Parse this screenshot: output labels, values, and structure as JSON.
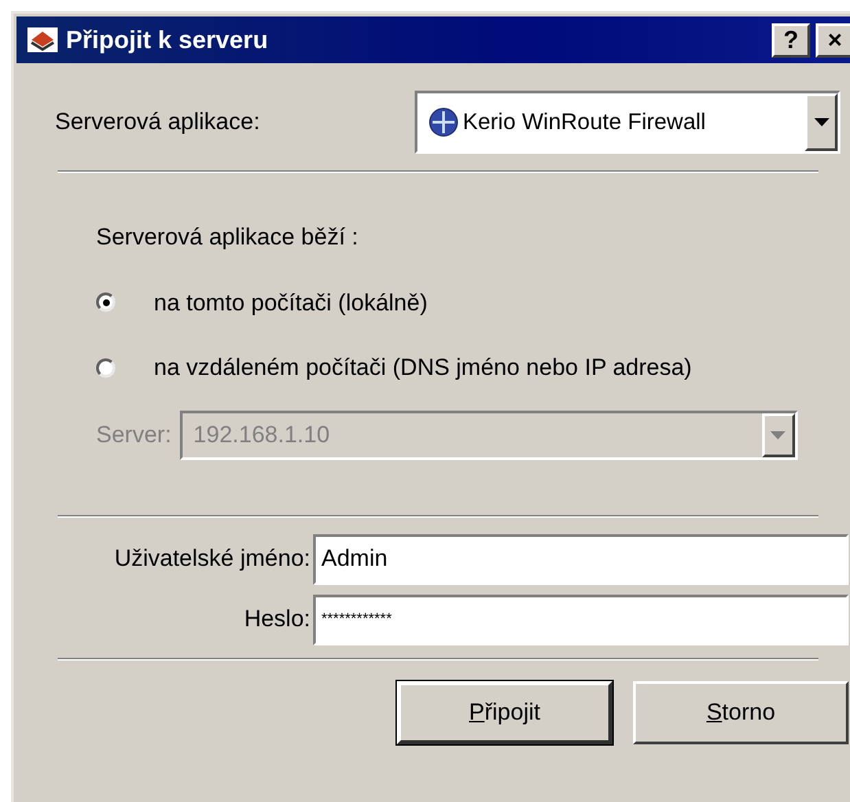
{
  "window": {
    "title": "Připojit k serveru",
    "title_buttons": [
      "?",
      "×"
    ]
  },
  "app_select": {
    "label": "Serverová aplikace:",
    "value": "Kerio WinRoute Firewall"
  },
  "location": {
    "heading": "Serverová aplikace běží :",
    "options": [
      {
        "label": "na tomto počítači (lokálně)",
        "selected": true
      },
      {
        "label": "na vzdáleném počítači (DNS jméno nebo IP adresa)",
        "selected": false
      }
    ]
  },
  "server": {
    "label": "Server:",
    "value": "192.168.1.10",
    "disabled": true
  },
  "username": {
    "label": "Uživatelské jméno:",
    "value": "Admin"
  },
  "password": {
    "label": "Heslo:",
    "value": "************"
  },
  "buttons": [
    {
      "mnemonic": "P",
      "rest": "řipojit",
      "default": true
    },
    {
      "mnemonic": "S",
      "rest": "torno",
      "default": false
    }
  ]
}
